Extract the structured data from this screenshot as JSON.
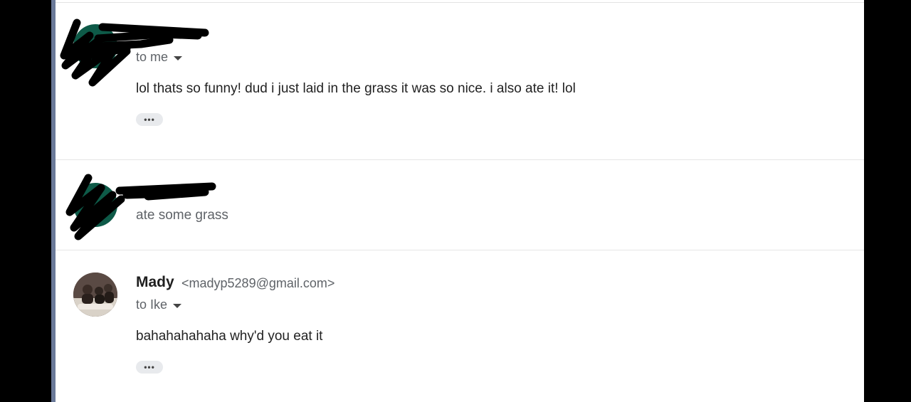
{
  "messages": [
    {
      "sender_name": "",
      "recipient_label": "to me",
      "body": "lol thats so funny! dud i just laid in the grass it was so nice. i also ate it! lol",
      "more_label": "•••"
    },
    {
      "sender_name": "",
      "snippet": "ate some grass"
    },
    {
      "sender_name": "Mady",
      "sender_email": "<madyp5289@gmail.com>",
      "recipient_label": "to Ike",
      "body": "bahahahahaha why'd you eat it",
      "more_label": "•••"
    }
  ],
  "colors": {
    "avatar_green": "#0e5a48",
    "accent_bar": "#6b7a99",
    "redaction": "#000000"
  },
  "icons": [
    "chevron-down-icon",
    "more-options-icon"
  ]
}
